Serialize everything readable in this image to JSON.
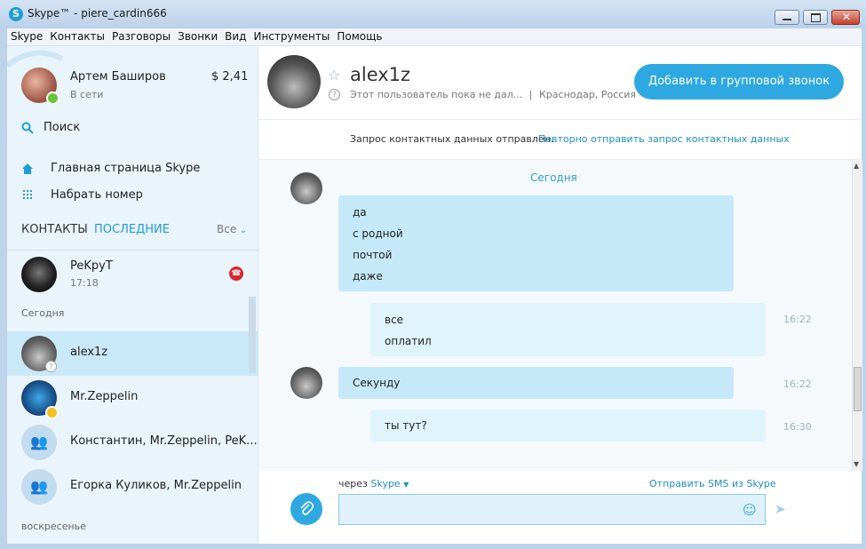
{
  "window": {
    "title": "Skype™ - piere_cardin666",
    "app_icon": "S"
  },
  "menu": [
    "Skype",
    "Контакты",
    "Разговоры",
    "Звонки",
    "Вид",
    "Инструменты",
    "Помощь"
  ],
  "profile": {
    "name": "Артем Баширов",
    "status": "В сети",
    "balance": "$ 2,41"
  },
  "sidebar": {
    "search_label": "Поиск",
    "home_label": "Главная страница Skype",
    "dial_label": "Набрать номер",
    "tab_contacts": "КОНТАКТЫ",
    "tab_recent": "ПОСЛЕДНИЕ",
    "filter_label": "Все",
    "pinned": {
      "name": "PeKpyT",
      "time": "17:18"
    },
    "section_today": "Сегодня",
    "section_sunday": "воскресенье",
    "recent": [
      {
        "name": "alex1z"
      },
      {
        "name": "Mr.Zeppelin"
      },
      {
        "name": "Константин, Mr.Zeppelin, PeK..."
      },
      {
        "name": "Егорка Куликов, Mr.Zeppelin"
      }
    ]
  },
  "contact": {
    "name": "alex1z",
    "mood": "Этот пользователь пока не дал...",
    "separator": "|",
    "location": "Краснодар, Россия",
    "add_group_button": "Добавить в групповой звонок"
  },
  "request_bar": {
    "text": "Запрос контактных данных отправлен.",
    "resend_link": "Повторно отправить запрос контактных данных"
  },
  "chat": {
    "date_label": "Сегодня",
    "messages": [
      {
        "lines": [
          "да",
          "с родной",
          "почтой",
          "даже"
        ],
        "time": ""
      },
      {
        "lines": [
          "все",
          "оплатил"
        ],
        "time": "16:22"
      },
      {
        "lines": [
          "Секунду"
        ],
        "time": "16:22"
      },
      {
        "lines": [
          "ты тут?"
        ],
        "time": "16:30"
      }
    ]
  },
  "composer": {
    "via_prefix": "через",
    "via_service": "Skype",
    "sms_link": "Отправить SMS из Skype",
    "input_value": ""
  },
  "colors": {
    "accent": "#2ea8e0",
    "incoming_bubble": "#c5e9f9",
    "outgoing_bubble": "#e0f4fc",
    "selected_row": "#c9e8f8",
    "missed_call": "#d9262c",
    "online": "#6ac43c"
  },
  "icons": {
    "search": "search-icon",
    "home": "home-icon",
    "dial": "dialpad-icon",
    "attach": "paperclip-icon",
    "emoji": "emoji-icon",
    "send": "send-icon",
    "missed_call": "missed-call-icon",
    "favorite": "star-icon"
  }
}
